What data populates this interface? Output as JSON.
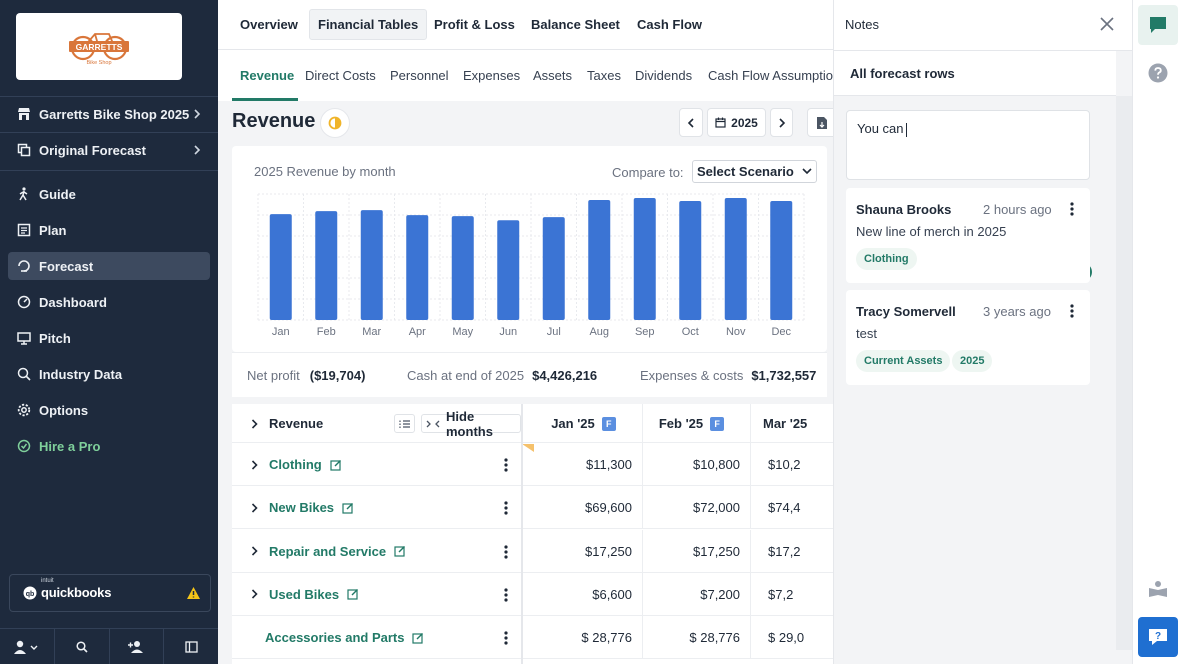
{
  "sidebar": {
    "logo_text": "GARRETTS",
    "logo_sub": "Bike Shop",
    "company": "Garretts Bike Shop 2025",
    "forecast_version": "Original Forecast",
    "nav": [
      {
        "label": "Guide",
        "icon": "hiker-icon",
        "active": false
      },
      {
        "label": "Plan",
        "icon": "document-icon",
        "active": false
      },
      {
        "label": "Forecast",
        "icon": "forecast-icon",
        "active": true
      },
      {
        "label": "Dashboard",
        "icon": "dashboard-icon",
        "active": false
      },
      {
        "label": "Pitch",
        "icon": "monitor-icon",
        "active": false
      },
      {
        "label": "Industry Data",
        "icon": "industry-search-icon",
        "active": false
      },
      {
        "label": "Options",
        "icon": "gear-icon",
        "active": false
      }
    ],
    "hire": "Hire a Pro",
    "quickbooks": {
      "brand_small": "intuit",
      "label": "quickbooks"
    }
  },
  "top_tabs": [
    "Overview",
    "Financial Tables",
    "Profit & Loss",
    "Balance Sheet",
    "Cash Flow"
  ],
  "active_top_tab": "Financial Tables",
  "sub_tabs": [
    "Revenue",
    "Direct Costs",
    "Personnel",
    "Expenses",
    "Assets",
    "Taxes",
    "Dividends",
    "Cash Flow Assumptions"
  ],
  "active_sub_tab": "Revenue",
  "page_title": "Revenue",
  "year": "2025",
  "compare": {
    "label": "Compare to:",
    "value": "Select Scenario"
  },
  "chart_data": {
    "type": "bar",
    "title": "2025 Revenue by month",
    "categories": [
      "Jan",
      "Feb",
      "Mar",
      "Apr",
      "May",
      "Jun",
      "Jul",
      "Aug",
      "Sep",
      "Oct",
      "Nov",
      "Dec"
    ],
    "values": [
      105000,
      108000,
      109000,
      104000,
      103000,
      99000,
      102000,
      119000,
      121000,
      118000,
      121000,
      118000
    ],
    "ylim": [
      0,
      125000
    ],
    "grid": true,
    "color": "#3b74d4"
  },
  "stats": [
    {
      "label": "Net profit",
      "value": "($19,704)"
    },
    {
      "label": "Cash at end of 2025",
      "value": "$4,426,216"
    },
    {
      "label": "Expenses & costs",
      "value": "$1,732,557"
    }
  ],
  "table": {
    "header": "Revenue",
    "hide_months": "Hide months",
    "columns": [
      {
        "label": "Jan '25",
        "badge": "F"
      },
      {
        "label": "Feb '25",
        "badge": "F"
      },
      {
        "label": "Mar '25",
        "badge": ""
      }
    ],
    "rows": [
      {
        "name": "Clothing",
        "values": [
          "$11,300",
          "$10,800",
          "$10,2"
        ]
      },
      {
        "name": "New Bikes",
        "values": [
          "$69,600",
          "$72,000",
          "$74,4"
        ]
      },
      {
        "name": "Repair and Service",
        "values": [
          "$17,250",
          "$17,250",
          "$17,2"
        ]
      },
      {
        "name": "Used Bikes",
        "values": [
          "$6,600",
          "$7,200",
          "$7,2"
        ]
      },
      {
        "name": "Accessories and Parts",
        "values": [
          "$ 28,776",
          "$ 28,776",
          "$ 29,0"
        ]
      }
    ]
  },
  "notes": {
    "title": "Notes",
    "filter": "All forecast rows",
    "draft": "You can",
    "items": [
      {
        "author": "Shauna Brooks",
        "time": "2 hours ago",
        "body": "New line of merch in 2025",
        "tags": [
          "Clothing"
        ]
      },
      {
        "author": "Tracy Somervell",
        "time": "3 years ago",
        "body": "test",
        "tags": [
          "Current Assets",
          "2025"
        ]
      }
    ]
  },
  "colors": {
    "sidebar": "#1e2a3d",
    "accent": "#227a67",
    "bar": "#3b74d4",
    "warn": "#f5c518"
  }
}
